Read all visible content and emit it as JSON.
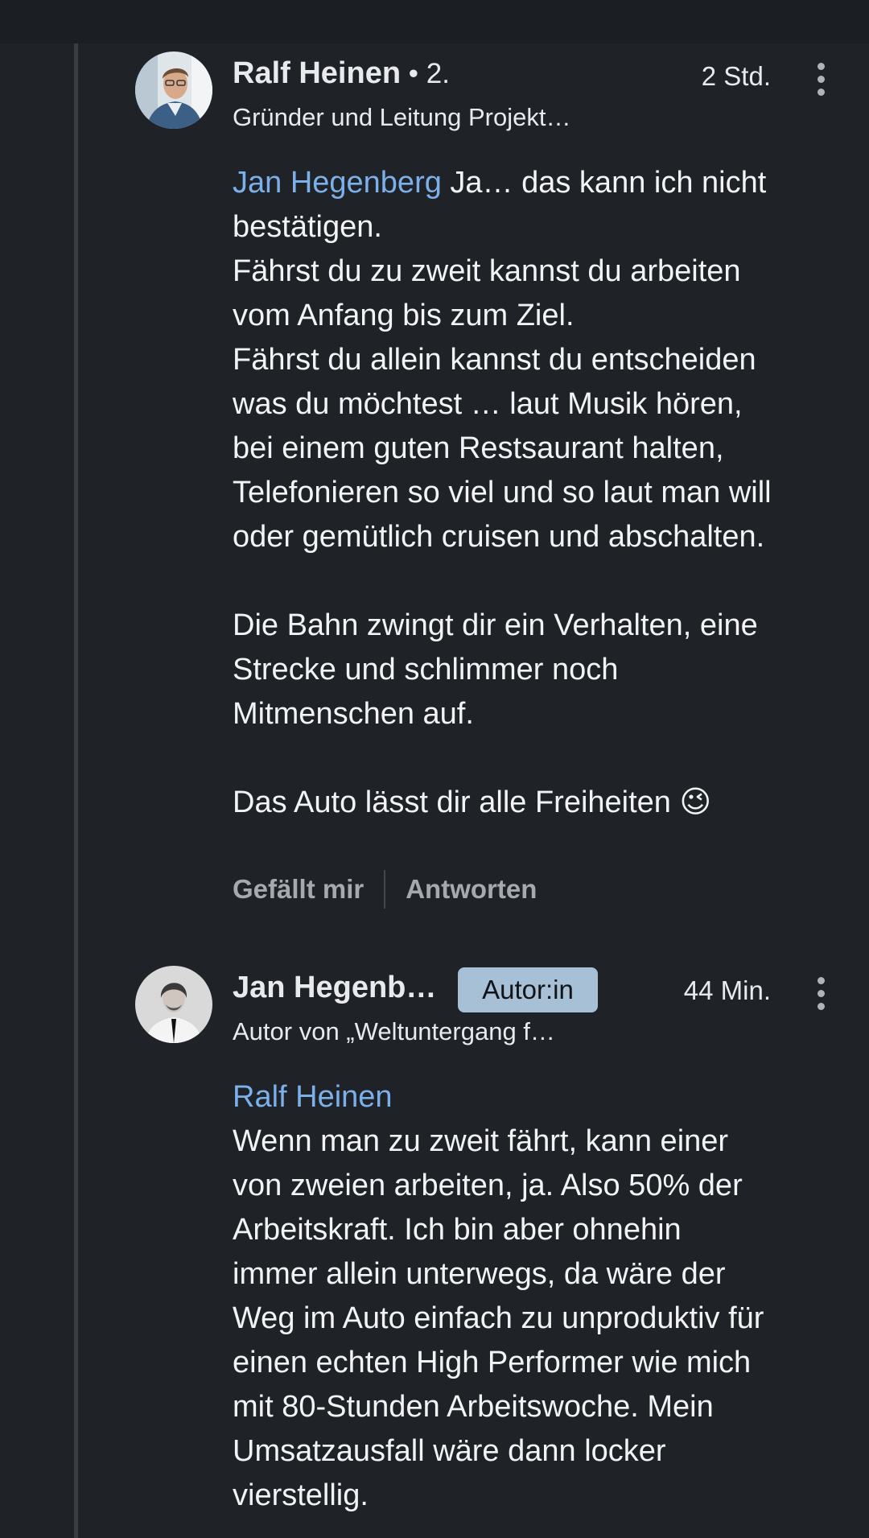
{
  "comments": [
    {
      "author": "Ralf Heinen",
      "degree": " • 2.",
      "time": "2 Std.",
      "headline": "Gründer und Leitung Projekt…",
      "mention": "Jan Hegenberg",
      "first_line_rest": " Ja… das kann ich nicht",
      "lines": [
        "bestätigen.",
        "Fährst du zu zweit kannst du arbeiten",
        "vom Anfang bis zum Ziel.",
        "Fährst du allein kannst du entscheiden",
        "was du möchtest … laut Musik hören,",
        "bei einem guten Restsaurant halten,",
        "Telefonieren so viel und so laut man will",
        "oder gemütlich cruisen und abschalten.",
        "",
        "Die Bahn zwingt dir ein Verhalten, eine",
        "Strecke und schlimmer noch",
        "Mitmenschen auf.",
        "",
        "Das Auto lässt dir alle Freiheiten 😉"
      ],
      "actions": {
        "like_label": "Gefällt mir",
        "reply_label": "Antworten"
      }
    },
    {
      "author": "Jan Hegenb…",
      "badge": "Autor:in",
      "time": "44 Min.",
      "headline": "Autor von „Weltuntergang f…",
      "mention": "Ralf Heinen",
      "lines": [
        "Wenn man zu zweit fährt, kann einer",
        "von zweien arbeiten, ja. Also 50% der",
        "Arbeitskraft. Ich bin aber ohnehin",
        "immer allein unterwegs, da wäre der",
        "Weg im Auto einfach zu unproduktiv für",
        "einen echten High Performer wie mich",
        "mit 80-Stunden Arbeitswoche. Mein",
        "Umsatzausfall wäre dann locker",
        "vierstellig."
      ]
    }
  ],
  "colors": {
    "background": "#1f2226",
    "mention": "#7cb0ea",
    "badge": "#a8c0d6",
    "thread_line": "#3a3e43"
  },
  "icons": [
    "more-vertical-icon"
  ]
}
